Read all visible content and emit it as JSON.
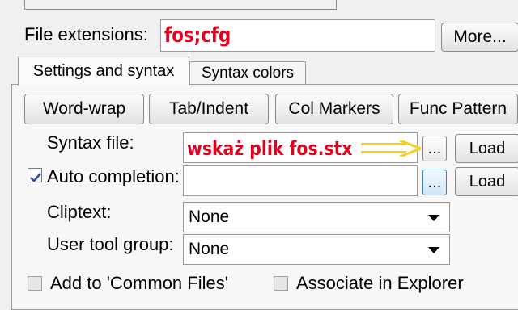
{
  "file_extensions": {
    "label": "File extensions:",
    "value": "fos;cfg",
    "more_button": "More..."
  },
  "tabs": [
    {
      "label": "Settings and syntax",
      "active": true
    },
    {
      "label": "Syntax colors",
      "active": false
    }
  ],
  "buttons": {
    "word_wrap": "Word-wrap",
    "tab_indent": "Tab/Indent",
    "col_markers": "Col Markers",
    "func_pattern": "Func Pattern"
  },
  "syntax_file": {
    "label": "Syntax file:",
    "annotation": "wskaż plik fos.stx",
    "browse": "...",
    "load": "Load"
  },
  "auto_completion": {
    "label": "Auto completion:",
    "checked": true,
    "browse": "...",
    "load": "Load"
  },
  "cliptext": {
    "label": "Cliptext:",
    "value": "None"
  },
  "user_tool_group": {
    "label": "User tool group:",
    "value": "None"
  },
  "bottom": {
    "common_files": "Add to 'Common Files'",
    "associate": "Associate in Explorer"
  },
  "colors": {
    "annotation_red": "#e1001e",
    "arrow_yellow": "#f2d21c",
    "accent_blue": "#3c7fb1"
  }
}
